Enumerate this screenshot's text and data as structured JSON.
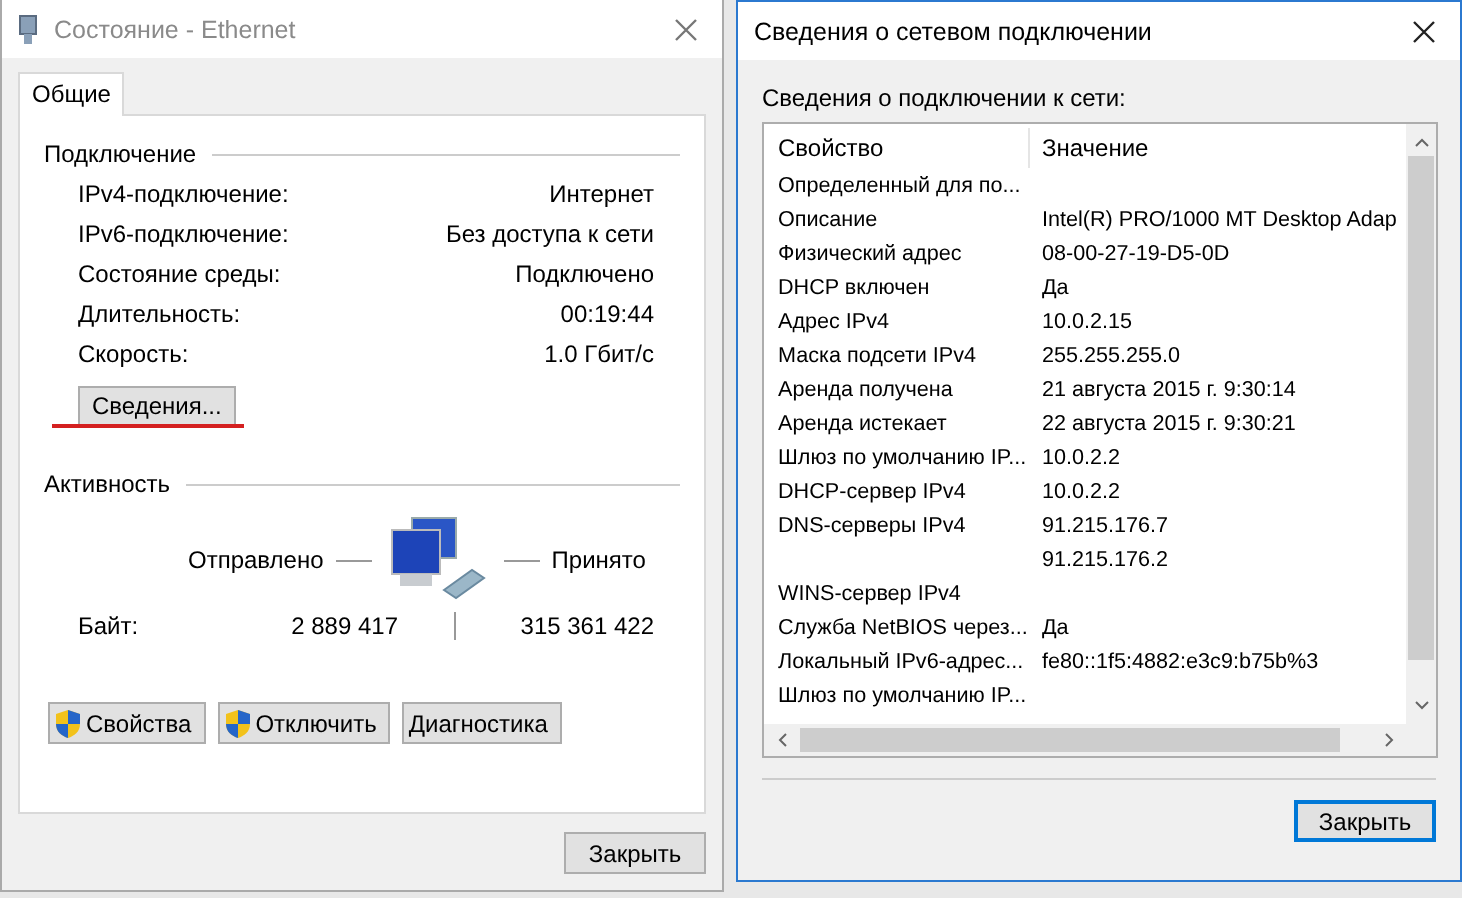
{
  "status_window": {
    "title": "Состояние - Ethernet",
    "tabs": [
      {
        "label": "Общие",
        "selected": true
      }
    ],
    "connection": {
      "heading": "Подключение",
      "rows": [
        {
          "label": "IPv4-подключение:",
          "value": "Интернет"
        },
        {
          "label": "IPv6-подключение:",
          "value": "Без доступа к сети"
        },
        {
          "label": "Состояние среды:",
          "value": "Подключено"
        },
        {
          "label": "Длительность:",
          "value": "00:19:44"
        },
        {
          "label": "Скорость:",
          "value": "1.0 Гбит/с"
        }
      ],
      "details_button": "Сведения..."
    },
    "activity": {
      "heading": "Активность",
      "sent_label": "Отправлено",
      "received_label": "Принято",
      "bytes_label": "Байт:",
      "bytes_sent": "2 889 417",
      "bytes_received": "315 361 422"
    },
    "buttons": [
      {
        "label": "Свойства",
        "kind": "shield"
      },
      {
        "label": "Отключить",
        "kind": "shield"
      },
      {
        "label": "Диагностика",
        "kind": "plain"
      }
    ],
    "close_button": "Закрыть"
  },
  "details_window": {
    "title": "Сведения о сетевом подключении",
    "caption": "Сведения о подключении к сети:",
    "columns": [
      "Свойство",
      "Значение"
    ],
    "rows": [
      {
        "property": "Определенный для по..."
      },
      {
        "property": "Описание",
        "value": "Intel(R) PRO/1000 MT Desktop Adap"
      },
      {
        "property": "Физический адрес",
        "value": "08-00-27-19-D5-0D"
      },
      {
        "property": "DHCP включен",
        "value": "Да"
      },
      {
        "property": "Адрес IPv4",
        "value": "10.0.2.15"
      },
      {
        "property": "Маска подсети IPv4",
        "value": "255.255.255.0"
      },
      {
        "property": "Аренда получена",
        "value": "21 августа 2015 г. 9:30:14"
      },
      {
        "property": "Аренда истекает",
        "value": "22 августа 2015 г. 9:30:21"
      },
      {
        "property": "Шлюз по умолчанию IP...",
        "value": "10.0.2.2"
      },
      {
        "property": "DHCP-сервер IPv4",
        "value": "10.0.2.2"
      },
      {
        "property": "DNS-серверы IPv4",
        "value": "91.215.176.7"
      },
      {
        "value": "91.215.176.2"
      },
      {
        "property": "WINS-сервер IPv4"
      },
      {
        "property": "Служба NetBIOS через...",
        "value": "Да"
      },
      {
        "property": "Локальный IPv6-адрес...",
        "value": "fe80::1f5:4882:e3c9:b75b%3"
      },
      {
        "property": "Шлюз по умолчанию IP..."
      }
    ],
    "close_button": "Закрыть"
  }
}
